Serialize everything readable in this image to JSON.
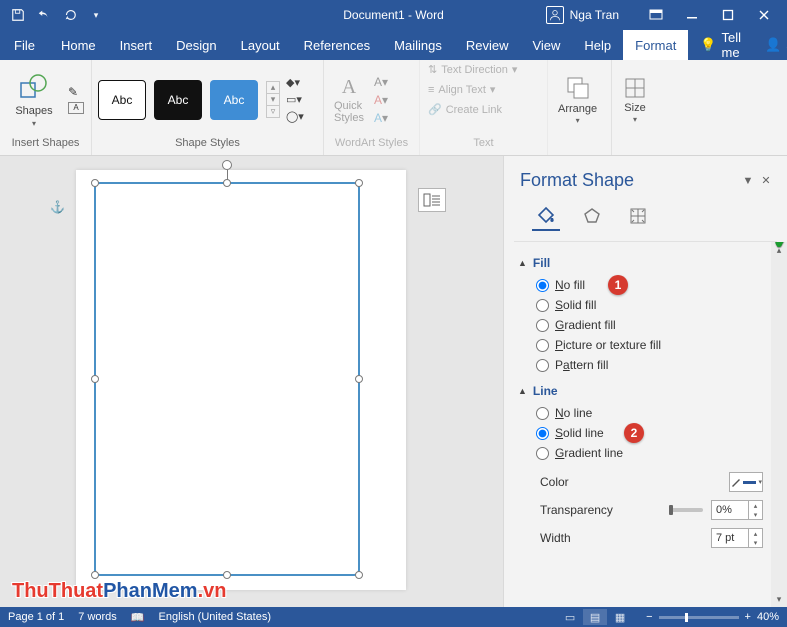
{
  "titlebar": {
    "document_name": "Document1 - Word",
    "user_name": "Nga Tran"
  },
  "tabs": {
    "file": "File",
    "home": "Home",
    "insert": "Insert",
    "design": "Design",
    "layout": "Layout",
    "references": "References",
    "mailings": "Mailings",
    "review": "Review",
    "view": "View",
    "help": "Help",
    "format": "Format",
    "tellme": "Tell me",
    "share": "Share"
  },
  "ribbon": {
    "shapes": "Shapes",
    "insert_shapes_group": "Insert Shapes",
    "abc": "Abc",
    "shape_styles_group": "Shape Styles",
    "quick_styles": "Quick\nStyles",
    "wordart_styles_group": "WordArt Styles",
    "text_direction": "Text Direction",
    "align_text": "Align Text",
    "create_link": "Create Link",
    "text_group": "Text",
    "arrange": "Arrange",
    "size": "Size"
  },
  "pane": {
    "title": "Format Shape",
    "fill_section": "Fill",
    "no_fill": "No fill",
    "solid_fill": "Solid fill",
    "gradient_fill": "Gradient fill",
    "picture_fill": "Picture or texture fill",
    "pattern_fill": "Pattern fill",
    "line_section": "Line",
    "no_line": "No line",
    "solid_line": "Solid line",
    "gradient_line": "Gradient line",
    "color_label": "Color",
    "transparency_label": "Transparency",
    "transparency_value": "0%",
    "width_label": "Width",
    "width_value": "7 pt"
  },
  "callouts": {
    "c1": "1",
    "c2": "2"
  },
  "status": {
    "page": "Page 1 of 1",
    "words": "7 words",
    "lang": "English (United States)",
    "zoom": "40%"
  },
  "watermark": {
    "a": "ThuThuat",
    "b": "PhanMem",
    "c": ".vn"
  }
}
